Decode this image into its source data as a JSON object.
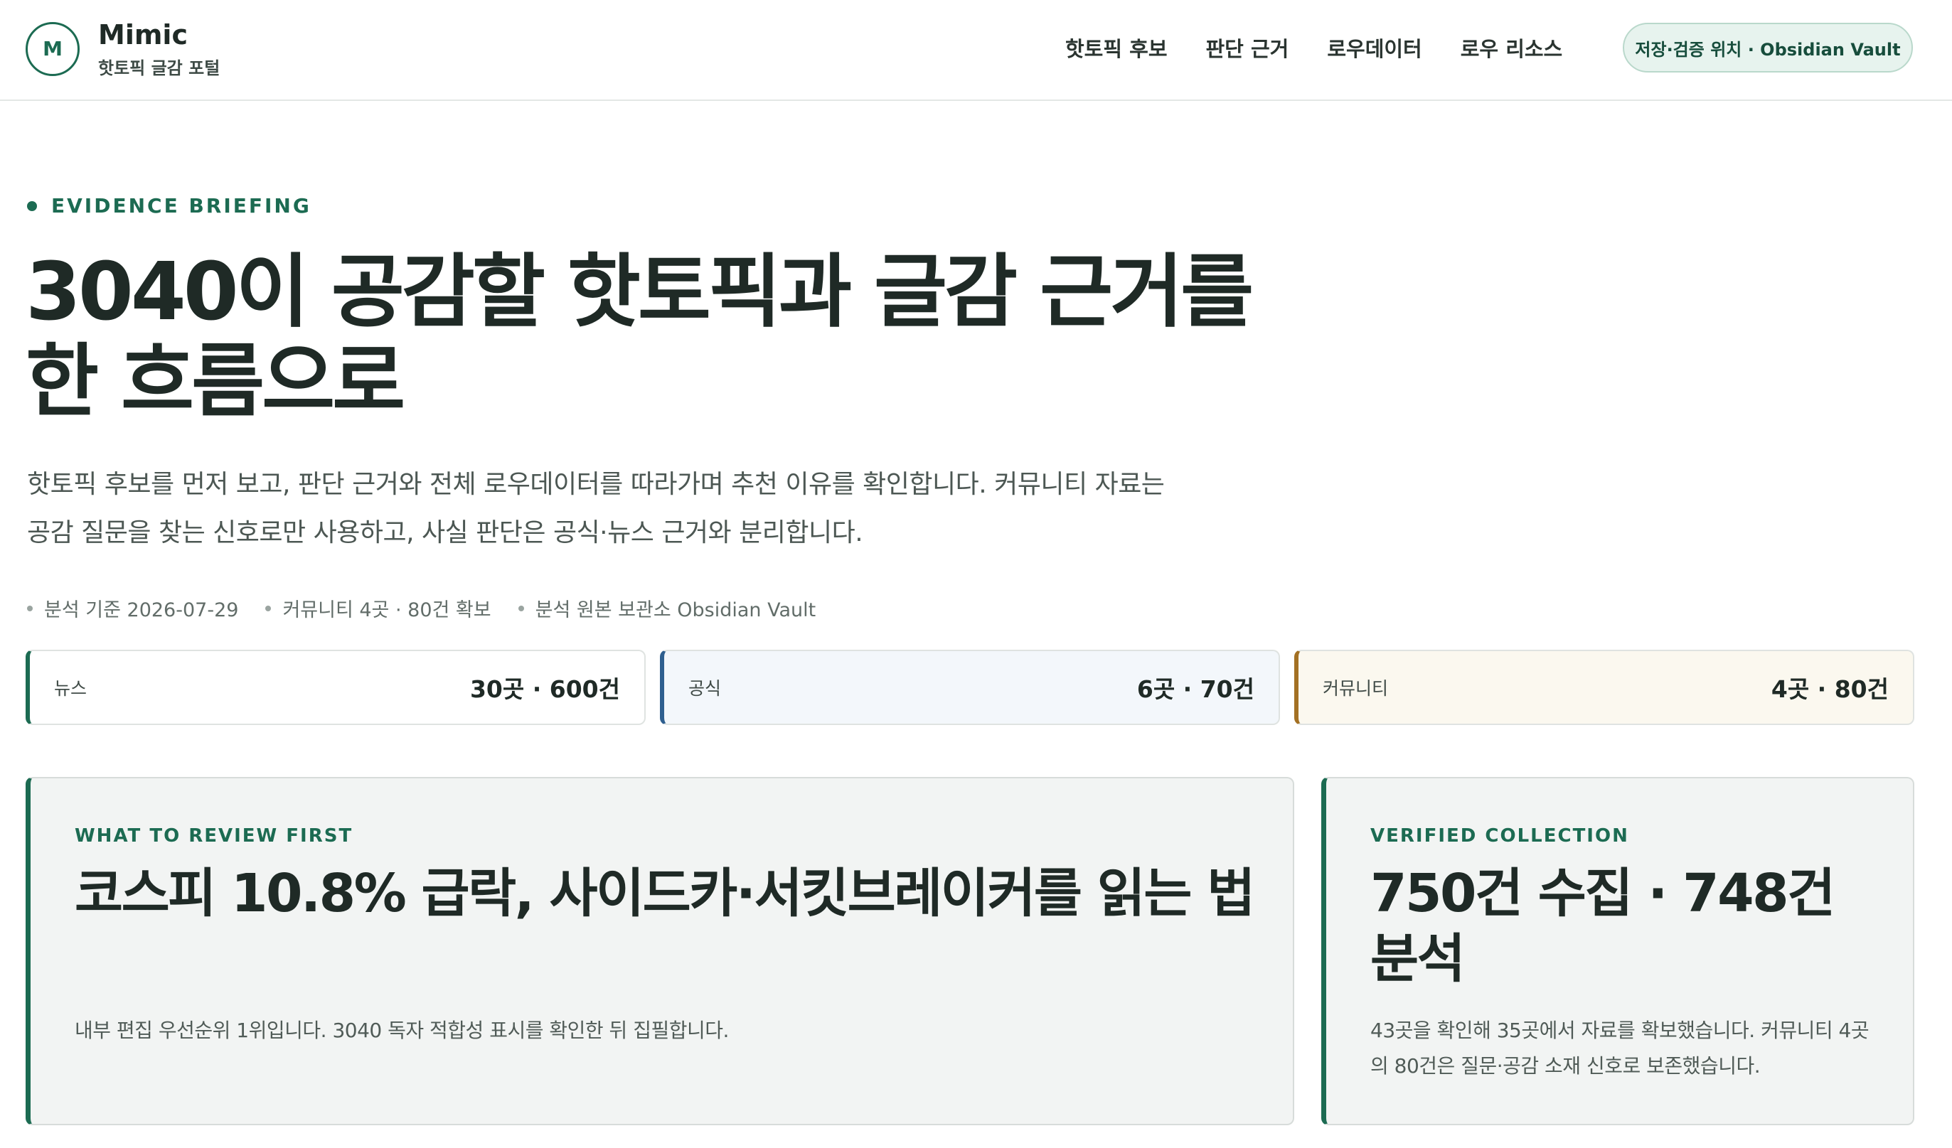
{
  "header": {
    "logo_letter": "M",
    "brand_name": "Mimic",
    "brand_sub": "핫토픽 글감 포털",
    "nav": [
      {
        "label": "핫토픽 후보"
      },
      {
        "label": "판단 근거"
      },
      {
        "label": "로우데이터"
      },
      {
        "label": "로우 리소스"
      }
    ],
    "vault_pill": "저장·검증 위치 · Obsidian Vault"
  },
  "hero": {
    "eyebrow": "EVIDENCE BRIEFING",
    "title_line1": "3040이 공감할 핫토픽과 글감 근거를",
    "title_line2": "한 흐름으로",
    "desc_line1": "핫토픽 후보를 먼저 보고, 판단 근거와 전체 로우데이터를 따라가며 추천 이유를 확인합니다. 커뮤니티 자료는",
    "desc_line2": "공감 질문을 찾는 신호로만 사용하고, 사실 판단은 공식·뉴스 근거와 분리합니다.",
    "meta": [
      "분석 기준 2026-07-29",
      "커뮤니티 4곳 · 80건 확보",
      "분석 원본 보관소 Obsidian Vault"
    ]
  },
  "sources": [
    {
      "label": "뉴스",
      "value": "30곳 · 600건"
    },
    {
      "label": "공식",
      "value": "6곳 · 70건"
    },
    {
      "label": "커뮤니티",
      "value": "4곳 · 80건"
    }
  ],
  "review_first": {
    "kicker": "WHAT TO REVIEW FIRST",
    "title": "코스피 10.8% 급락, 사이드카·서킷브레이커를 읽는 법",
    "desc": "내부 편집 우선순위 1위입니다. 3040 독자 적합성 표시를 확인한 뒤 집필합니다."
  },
  "verified": {
    "kicker": "VERIFIED COLLECTION",
    "title": "750건 수집 · 748건 분석",
    "desc": "43곳을 확인해 35곳에서 자료를 확보했습니다. 커뮤니티 4곳의 80건은 질문·공감 소재 신호로 보존했습니다."
  },
  "colors": {
    "accent": "#1c6b52",
    "official": "#2e5f8f",
    "community": "#a37023"
  }
}
